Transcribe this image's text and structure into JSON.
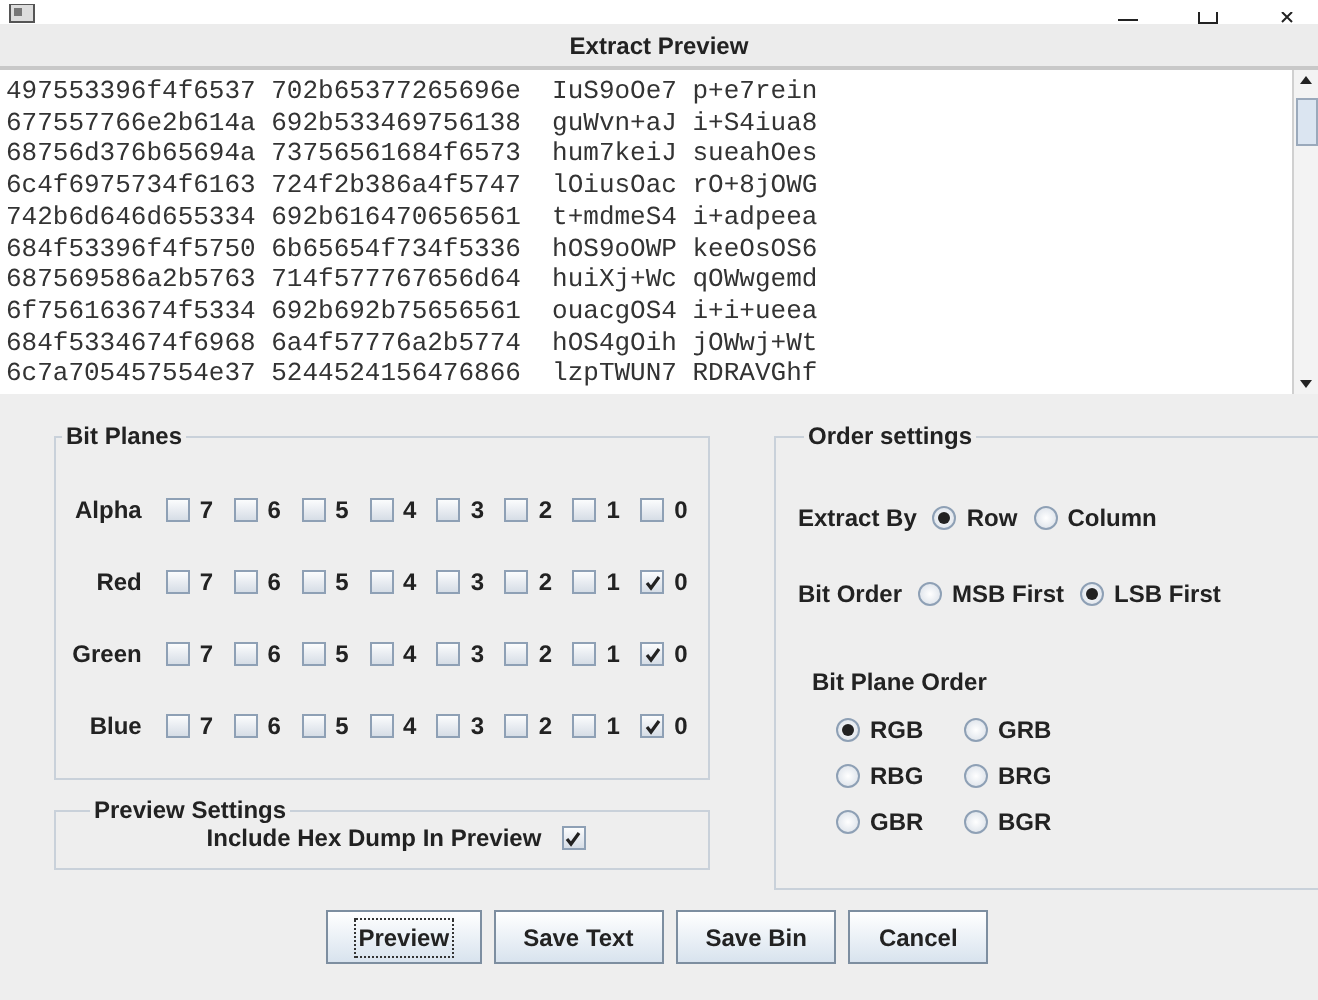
{
  "header": "Extract Preview",
  "preview_lines": [
    "497553396f4f6537 702b65377265696e  IuS9oOe7 p+e7rein",
    "677557766e2b614a 692b533469756138  guWvn+aJ i+S4iua8",
    "68756d376b65694a 73756561684f6573  hum7keiJ sueahOes",
    "6c4f6975734f6163 724f2b386a4f5747  lOiusOac rO+8jOWG",
    "742b6d646d655334 692b616470656561  t+mdmeS4 i+adpeea",
    "684f53396f4f5750 6b65654f734f5336  hOS9oOWP keeOsOS6",
    "687569586a2b5763 714f577767656d64  huiXj+Wc qOWwgemd",
    "6f756163674f5334 692b692b75656561  ouacgOS4 i+i+ueea",
    "684f5334674f6968 6a4f57776a2b5774  hOS4gOih jOWwj+Wt",
    "6c7a705457554e37 5244524156476866  lzpTWUN7 RDRAVGhf"
  ],
  "bit_planes": {
    "title": "Bit Planes",
    "rows": [
      {
        "label": "Alpha",
        "bits": [
          {
            "label": "7",
            "checked": false
          },
          {
            "label": "6",
            "checked": false
          },
          {
            "label": "5",
            "checked": false
          },
          {
            "label": "4",
            "checked": false
          },
          {
            "label": "3",
            "checked": false
          },
          {
            "label": "2",
            "checked": false
          },
          {
            "label": "1",
            "checked": false
          },
          {
            "label": "0",
            "checked": false
          }
        ]
      },
      {
        "label": "Red",
        "bits": [
          {
            "label": "7",
            "checked": false
          },
          {
            "label": "6",
            "checked": false
          },
          {
            "label": "5",
            "checked": false
          },
          {
            "label": "4",
            "checked": false
          },
          {
            "label": "3",
            "checked": false
          },
          {
            "label": "2",
            "checked": false
          },
          {
            "label": "1",
            "checked": false
          },
          {
            "label": "0",
            "checked": true
          }
        ]
      },
      {
        "label": "Green",
        "bits": [
          {
            "label": "7",
            "checked": false
          },
          {
            "label": "6",
            "checked": false
          },
          {
            "label": "5",
            "checked": false
          },
          {
            "label": "4",
            "checked": false
          },
          {
            "label": "3",
            "checked": false
          },
          {
            "label": "2",
            "checked": false
          },
          {
            "label": "1",
            "checked": false
          },
          {
            "label": "0",
            "checked": true
          }
        ]
      },
      {
        "label": "Blue",
        "bits": [
          {
            "label": "7",
            "checked": false
          },
          {
            "label": "6",
            "checked": false
          },
          {
            "label": "5",
            "checked": false
          },
          {
            "label": "4",
            "checked": false
          },
          {
            "label": "3",
            "checked": false
          },
          {
            "label": "2",
            "checked": false
          },
          {
            "label": "1",
            "checked": false
          },
          {
            "label": "0",
            "checked": true
          }
        ]
      }
    ]
  },
  "preview_settings": {
    "title": "Preview Settings",
    "include_hex_dump": {
      "label": "Include Hex Dump In Preview",
      "checked": true
    }
  },
  "order_settings": {
    "title": "Order settings",
    "extract_by": {
      "label": "Extract By",
      "options": [
        {
          "label": "Row",
          "selected": true
        },
        {
          "label": "Column",
          "selected": false
        }
      ]
    },
    "bit_order": {
      "label": "Bit Order",
      "options": [
        {
          "label": "MSB First",
          "selected": false
        },
        {
          "label": "LSB First",
          "selected": true
        }
      ]
    },
    "bit_plane_order": {
      "title": "Bit Plane Order",
      "options": [
        {
          "label": "RGB",
          "selected": true
        },
        {
          "label": "GRB",
          "selected": false
        },
        {
          "label": "RBG",
          "selected": false
        },
        {
          "label": "BRG",
          "selected": false
        },
        {
          "label": "GBR",
          "selected": false
        },
        {
          "label": "BGR",
          "selected": false
        }
      ]
    }
  },
  "buttons": [
    {
      "label": "Preview",
      "focused": true
    },
    {
      "label": "Save Text",
      "focused": false
    },
    {
      "label": "Save Bin",
      "focused": false
    },
    {
      "label": "Cancel",
      "focused": false
    }
  ]
}
